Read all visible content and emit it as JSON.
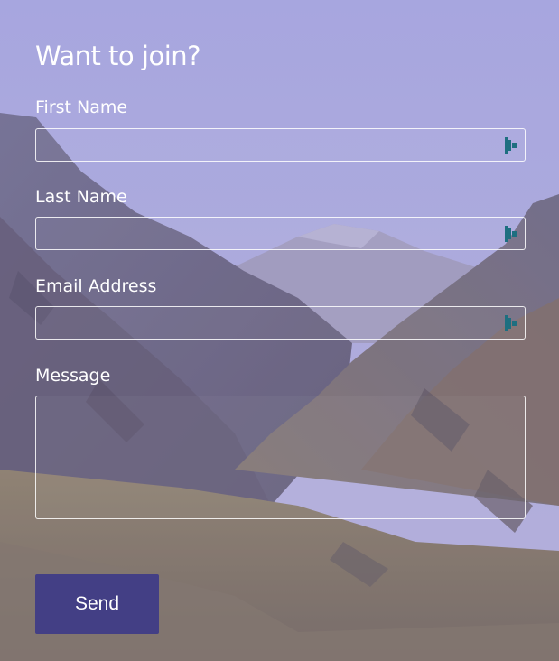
{
  "form": {
    "title": "Want to join?",
    "fields": [
      {
        "label": "First Name",
        "value": "",
        "placeholder": ""
      },
      {
        "label": "Last Name",
        "value": "",
        "placeholder": ""
      },
      {
        "label": "Email Address",
        "value": "",
        "placeholder": ""
      }
    ],
    "message": {
      "label": "Message",
      "value": "",
      "placeholder": ""
    },
    "submit_label": "Send"
  },
  "colors": {
    "overlay_tint": "#a0a0e1",
    "button_bg": "#433f85",
    "text": "#ffffff",
    "autofill_icon": "#1e6f80"
  },
  "icons": {
    "field_fill_icon": "autofill-key-icon",
    "background": "mountain-valley-photo"
  }
}
